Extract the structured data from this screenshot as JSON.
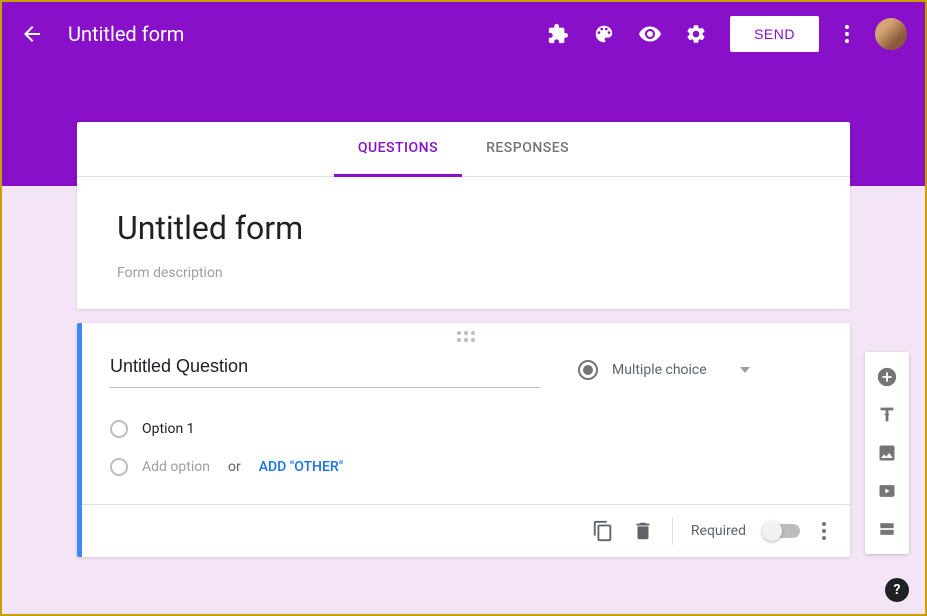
{
  "header": {
    "title": "Untitled form",
    "send_label": "SEND"
  },
  "tabs": {
    "questions": "QUESTIONS",
    "responses": "RESPONSES"
  },
  "form": {
    "title": "Untitled form",
    "description_placeholder": "Form description"
  },
  "question": {
    "title": "Untitled Question",
    "type_label": "Multiple choice",
    "option1": "Option 1",
    "add_option": "Add option",
    "or_text": "or",
    "add_other": "ADD \"OTHER\"",
    "required_label": "Required"
  },
  "help": "?"
}
